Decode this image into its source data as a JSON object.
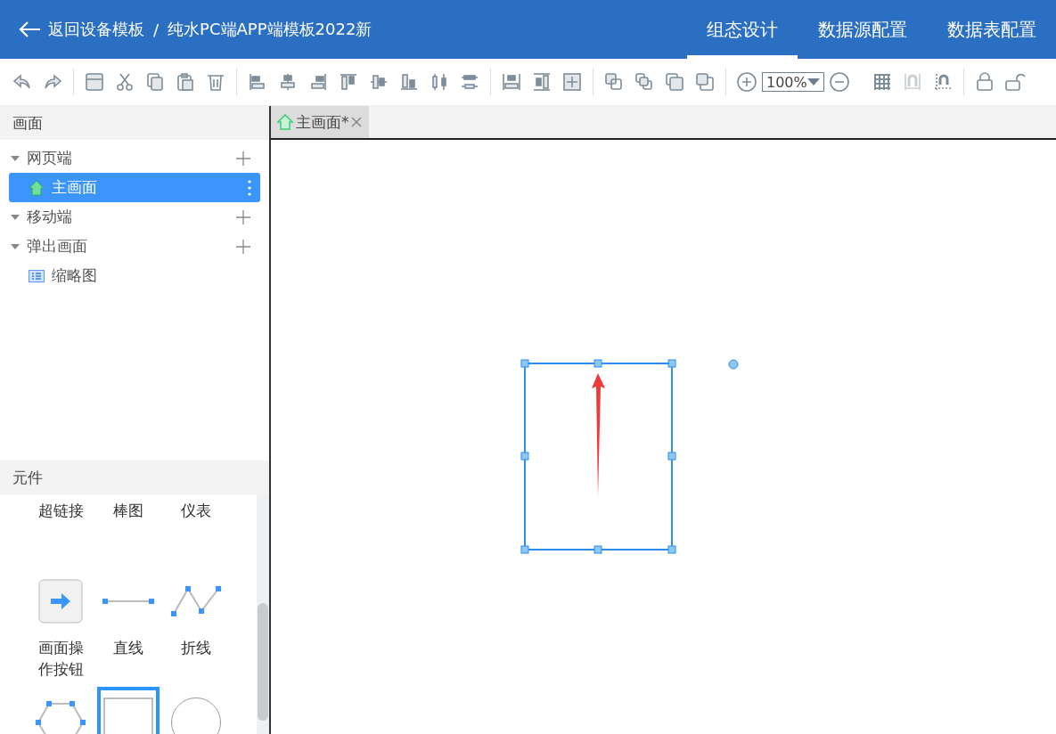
{
  "header": {
    "back_label": "返回设备模板",
    "separator": "/",
    "project": "纯水PC端APP端模板2022新",
    "tabs": [
      {
        "label": "组态设计",
        "selected": true
      },
      {
        "label": "数据源配置",
        "selected": false
      },
      {
        "label": "数据表配置",
        "selected": false
      }
    ]
  },
  "toolbar": {
    "zoom": "100%"
  },
  "screens_panel": {
    "title": "画面",
    "tree": [
      {
        "label": "网页端",
        "expanded": true,
        "children": [
          {
            "label": "主画面",
            "selected": true,
            "kind": "home"
          }
        ]
      },
      {
        "label": "移动端",
        "expanded": true
      },
      {
        "label": "弹出画面",
        "expanded": true,
        "children": [
          {
            "label": "缩略图",
            "selected": false,
            "kind": "list"
          }
        ]
      }
    ]
  },
  "components_panel": {
    "title": "元件",
    "items": [
      {
        "label": "超链接",
        "kind": "none"
      },
      {
        "label": "棒图",
        "kind": "none"
      },
      {
        "label": "仪表",
        "kind": "none"
      },
      {
        "label": "画面操作按钮",
        "kind": "button",
        "selected": false
      },
      {
        "label": "直线",
        "kind": "line",
        "selected": false
      },
      {
        "label": "折线",
        "kind": "polyline",
        "selected": false
      },
      {
        "kind": "hexagon",
        "selected": false
      },
      {
        "kind": "rect",
        "selected": true
      },
      {
        "kind": "circle",
        "selected": false
      }
    ]
  },
  "editor_tabs": [
    {
      "label": "主画面*",
      "selected": true
    }
  ]
}
